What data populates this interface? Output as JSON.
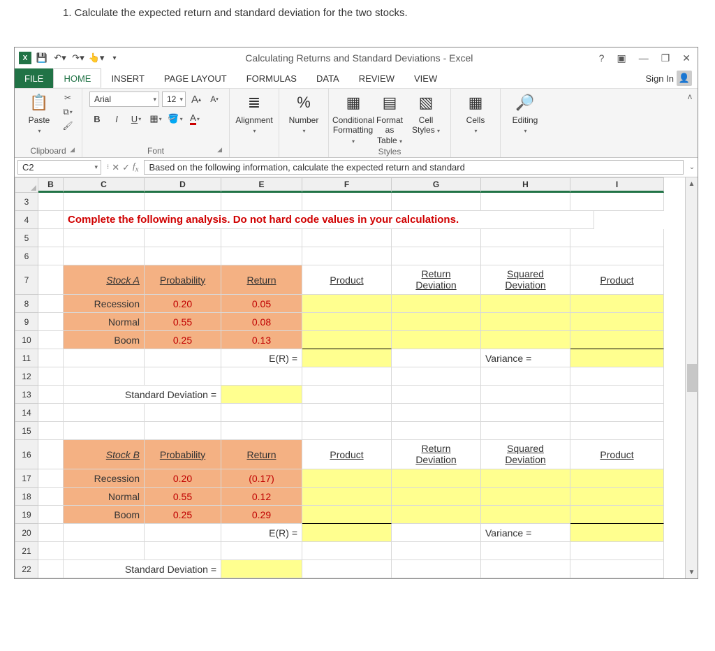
{
  "question": "1. Calculate the expected return and standard deviation for the two stocks.",
  "title": "Calculating Returns and Standard Deviations - Excel",
  "tabs": {
    "file": "FILE",
    "home": "HOME",
    "insert": "INSERT",
    "pagelayout": "PAGE LAYOUT",
    "formulas": "FORMULAS",
    "data": "DATA",
    "review": "REVIEW",
    "view": "VIEW"
  },
  "signin": "Sign In",
  "ribbon": {
    "font_name": "Arial",
    "font_size": "12",
    "groups": {
      "clipboard": "Clipboard",
      "font": "Font",
      "styles": "Styles"
    },
    "paste": "Paste",
    "alignment": "Alignment",
    "number": "Number",
    "cond_fmt1": "Conditional",
    "cond_fmt2": "Formatting",
    "fmt_table1": "Format as",
    "fmt_table2": "Table",
    "cell_styles1": "Cell",
    "cell_styles2": "Styles",
    "cells": "Cells",
    "editing": "Editing"
  },
  "name_box": "C2",
  "formula": "Based on the following information, calculate the expected return and standard",
  "columns": [
    "B",
    "C",
    "D",
    "E",
    "F",
    "G",
    "H",
    "I"
  ],
  "rows_visible": [
    "3",
    "4",
    "5",
    "6",
    "7",
    "8",
    "9",
    "10",
    "11",
    "12",
    "13",
    "14",
    "15",
    "16",
    "17",
    "18",
    "19",
    "20",
    "21",
    "22"
  ],
  "instruction": "Complete the following analysis. Do not hard code values in your calculations.",
  "headers": {
    "stockA": "Stock A",
    "stockB": "Stock B",
    "probability": "Probability",
    "return": "Return",
    "product": "Product",
    "return_dev1": "Return",
    "return_dev2": "Deviation",
    "sq_dev1": "Squared",
    "sq_dev2": "Deviation",
    "product2": "Product",
    "er": "E(R) =",
    "variance": "Variance =",
    "stddev": "Standard Deviation ="
  },
  "stockA": {
    "rows": [
      {
        "state": "Recession",
        "prob": "0.20",
        "ret": "0.05"
      },
      {
        "state": "Normal",
        "prob": "0.55",
        "ret": "0.08"
      },
      {
        "state": "Boom",
        "prob": "0.25",
        "ret": "0.13"
      }
    ]
  },
  "stockB": {
    "rows": [
      {
        "state": "Recession",
        "prob": "0.20",
        "ret": "(0.17)"
      },
      {
        "state": "Normal",
        "prob": "0.55",
        "ret": "0.12"
      },
      {
        "state": "Boom",
        "prob": "0.25",
        "ret": "0.29"
      }
    ]
  },
  "chart_data": {
    "type": "table",
    "title": "Expected return and standard deviation inputs",
    "series": [
      {
        "name": "Stock A",
        "states": [
          "Recession",
          "Normal",
          "Boom"
        ],
        "probability": [
          0.2,
          0.55,
          0.25
        ],
        "return": [
          0.05,
          0.08,
          0.13
        ]
      },
      {
        "name": "Stock B",
        "states": [
          "Recession",
          "Normal",
          "Boom"
        ],
        "probability": [
          0.2,
          0.55,
          0.25
        ],
        "return": [
          -0.17,
          0.12,
          0.29
        ]
      }
    ]
  }
}
